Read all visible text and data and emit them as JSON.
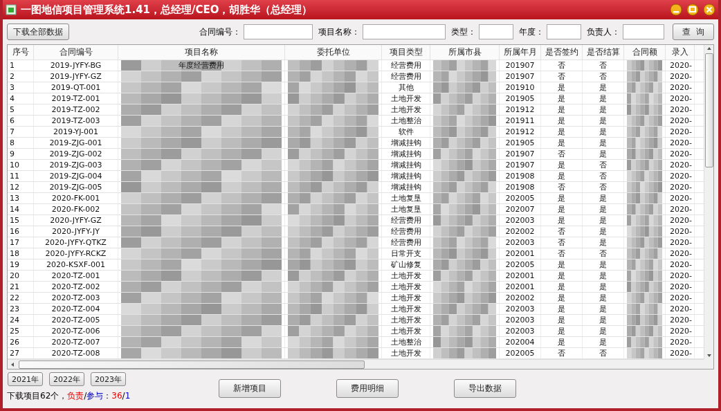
{
  "window": {
    "title": "一图地信项目管理系统1.41，总经理/CEO，胡胜华（总经理）"
  },
  "toolbar": {
    "download_button": "下载全部数据",
    "filters": [
      {
        "label": "合同编号："
      },
      {
        "label": "项目名称："
      },
      {
        "label": "类型："
      },
      {
        "label": "年度："
      },
      {
        "label": "负责人："
      }
    ],
    "query_button": "查  询"
  },
  "table": {
    "columns": [
      {
        "title": "序号",
        "kind": "text"
      },
      {
        "title": "合同编号",
        "kind": "text"
      },
      {
        "title": "项目名称",
        "kind": "masked"
      },
      {
        "title": "委托单位",
        "kind": "masked"
      },
      {
        "title": "项目类型",
        "kind": "text"
      },
      {
        "title": "所属市县",
        "kind": "masked"
      },
      {
        "title": "所属年月",
        "kind": "text"
      },
      {
        "title": "是否签约",
        "kind": "text"
      },
      {
        "title": "是否结算",
        "kind": "text"
      },
      {
        "title": "合同额",
        "kind": "masked"
      },
      {
        "title": "录入",
        "kind": "text"
      }
    ],
    "rows": [
      [
        "1",
        "2019-JYFY-BG",
        "年度经营费用",
        null,
        "经营费用",
        null,
        "201907",
        "否",
        "否",
        null,
        "2020-"
      ],
      [
        "2",
        "2019-JYFY-GZ",
        null,
        null,
        "经营费用",
        null,
        "201907",
        "否",
        "否",
        null,
        "2020-"
      ],
      [
        "3",
        "2019-QT-001",
        null,
        null,
        "其他",
        null,
        "201910",
        "是",
        "是",
        null,
        "2020-"
      ],
      [
        "4",
        "2019-TZ-001",
        null,
        null,
        "土地开发",
        null,
        "201905",
        "是",
        "是",
        null,
        "2020-"
      ],
      [
        "5",
        "2019-TZ-002",
        null,
        null,
        "土地开发",
        null,
        "201912",
        "是",
        "是",
        null,
        "2020-"
      ],
      [
        "6",
        "2019-TZ-003",
        null,
        null,
        "土地整治",
        null,
        "201911",
        "是",
        "是",
        null,
        "2020-"
      ],
      [
        "7",
        "2019-YJ-001",
        null,
        null,
        "软件",
        null,
        "201912",
        "是",
        "是",
        null,
        "2020-"
      ],
      [
        "8",
        "2019-ZJG-001",
        null,
        null,
        "增减挂钩",
        null,
        "201905",
        "是",
        "是",
        null,
        "2020-"
      ],
      [
        "9",
        "2019-ZJG-002",
        null,
        null,
        "增减挂钩",
        null,
        "201907",
        "否",
        "是",
        null,
        "2020-"
      ],
      [
        "10",
        "2019-ZJG-003",
        null,
        null,
        "增减挂钩",
        null,
        "201907",
        "是",
        "否",
        null,
        "2020-"
      ],
      [
        "11",
        "2019-ZJG-004",
        null,
        null,
        "增减挂钩",
        null,
        "201908",
        "是",
        "否",
        null,
        "2020-"
      ],
      [
        "12",
        "2019-ZJG-005",
        null,
        null,
        "增减挂钩",
        null,
        "201908",
        "否",
        "否",
        null,
        "2020-"
      ],
      [
        "13",
        "2020-FK-001",
        null,
        null,
        "土地复垦",
        null,
        "202005",
        "是",
        "是",
        null,
        "2020-"
      ],
      [
        "14",
        "2020-FK-002",
        null,
        null,
        "土地复垦",
        null,
        "202007",
        "是",
        "是",
        null,
        "2020-"
      ],
      [
        "15",
        "2020-JYFY-GZ",
        null,
        null,
        "经营费用",
        null,
        "202003",
        "是",
        "是",
        null,
        "2020-"
      ],
      [
        "16",
        "2020-JYFY-JY",
        null,
        null,
        "经营费用",
        null,
        "202002",
        "否",
        "是",
        null,
        "2020-"
      ],
      [
        "17",
        "2020-JYFY-QTKZ",
        null,
        null,
        "经营费用",
        null,
        "202003",
        "否",
        "是",
        null,
        "2020-"
      ],
      [
        "18",
        "2020-JYFY-RCKZ",
        null,
        null,
        "日常开支",
        null,
        "202001",
        "否",
        "否",
        null,
        "2020-"
      ],
      [
        "19",
        "2020-KSXF-001",
        null,
        null,
        "矿山修复",
        null,
        "202005",
        "是",
        "是",
        null,
        "2020-"
      ],
      [
        "20",
        "2020-TZ-001",
        null,
        null,
        "土地开发",
        null,
        "202001",
        "是",
        "是",
        null,
        "2020-"
      ],
      [
        "21",
        "2020-TZ-002",
        null,
        null,
        "土地开发",
        null,
        "202001",
        "是",
        "是",
        null,
        "2020-"
      ],
      [
        "22",
        "2020-TZ-003",
        null,
        null,
        "土地开发",
        null,
        "202002",
        "是",
        "是",
        null,
        "2020-"
      ],
      [
        "23",
        "2020-TZ-004",
        null,
        null,
        "土地开发",
        null,
        "202003",
        "是",
        "是",
        null,
        "2020-"
      ],
      [
        "24",
        "2020-TZ-005",
        null,
        null,
        "土地开发",
        null,
        "202003",
        "是",
        "是",
        null,
        "2020-"
      ],
      [
        "25",
        "2020-TZ-006",
        null,
        null,
        "土地开发",
        null,
        "202003",
        "是",
        "是",
        null,
        "2020-"
      ],
      [
        "26",
        "2020-TZ-007",
        null,
        null,
        "土地整治",
        null,
        "202004",
        "是",
        "是",
        null,
        "2020-"
      ],
      [
        "27",
        "2020-TZ-008",
        null,
        null,
        "土地开发",
        null,
        "202005",
        "否",
        "否",
        null,
        "2020-"
      ]
    ]
  },
  "year_buttons": [
    "2021年",
    "2022年",
    "2023年"
  ],
  "summary": [
    {
      "text": "下载项目62个，",
      "kind": "plain"
    },
    {
      "text": "负责",
      "kind": "lead"
    },
    {
      "text": "/",
      "kind": "plain"
    },
    {
      "text": "参与",
      "kind": "join"
    },
    {
      "text": "：",
      "kind": "plain"
    },
    {
      "text": "36",
      "kind": "lead"
    },
    {
      "text": "/",
      "kind": "plain"
    },
    {
      "text": "1",
      "kind": "join"
    }
  ],
  "action_buttons": [
    "新增项目",
    "费用明细",
    "导出数据"
  ]
}
